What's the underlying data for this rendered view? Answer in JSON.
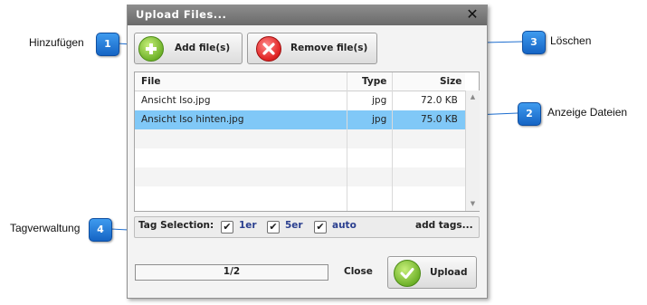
{
  "dialog": {
    "title": "Upload Files...",
    "close_glyph": "✕",
    "add_button": {
      "label": "Add file(s)",
      "icon": "plus-circle-icon"
    },
    "remove_button": {
      "label": "Remove file(s)",
      "icon": "x-circle-icon"
    },
    "table": {
      "headers": {
        "file": "File",
        "type": "Type",
        "size": "Size"
      },
      "rows": [
        {
          "file": "Ansicht Iso.jpg",
          "type": "jpg",
          "size": "72.0 KB"
        },
        {
          "file": "Ansicht Iso hinten.jpg",
          "type": "jpg",
          "size": "75.0 KB",
          "selected": true
        }
      ]
    },
    "tags": {
      "label": "Tag Selection:",
      "items": [
        {
          "name": "1er",
          "checked": true
        },
        {
          "name": "5er",
          "checked": true
        },
        {
          "name": "auto",
          "checked": true
        }
      ],
      "add_tags": "add tags..."
    },
    "progress": {
      "text": "1/2"
    },
    "close_label": "Close",
    "upload_button": {
      "label": "Upload",
      "icon": "check-circle-icon"
    }
  },
  "callouts": [
    {
      "number": "1",
      "text": "Hinzufügen"
    },
    {
      "number": "2",
      "text": "Anzeige Dateien"
    },
    {
      "number": "3",
      "text": "Löschen"
    },
    {
      "number": "4",
      "text": "Tagverwaltung"
    }
  ],
  "colors": {
    "title_bar": "#7a7a7a",
    "selected_row": "#80c8f7",
    "callout_badge": "#1f78d8",
    "add_icon": "#6fb22a",
    "remove_icon": "#e22626",
    "tag_text": "#2a3f8f"
  }
}
